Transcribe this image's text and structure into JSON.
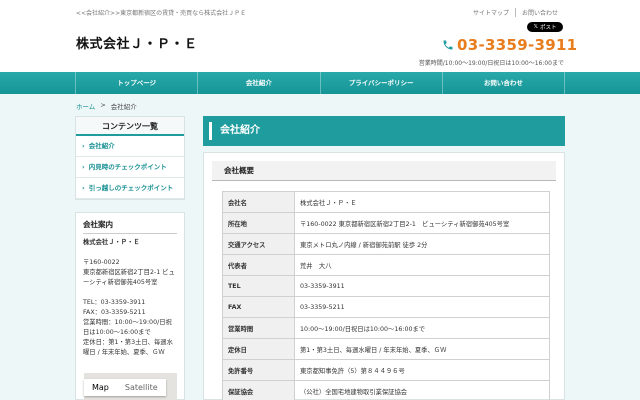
{
  "header": {
    "breadcrumb_text": "<<会社紹介>>東京都新宿区の賃貸・売買なら株式会社ＪＰＥ",
    "top_links": [
      "サイトマップ",
      "お問い合わせ"
    ],
    "post_button": "ポスト",
    "company_name": "株式会社Ｊ・Ｐ・Ｅ",
    "phone": "03-3359-3911",
    "hours": "営業時間/10:00〜19:00/日祝日は10:00〜16:00まで"
  },
  "nav": {
    "items": [
      "トップページ",
      "会社紹介",
      "プライバシーポリシー",
      "お問い合わせ"
    ]
  },
  "crumb": {
    "home": "ホーム",
    "separator": ">",
    "current": "会社紹介"
  },
  "sidebar": {
    "contents_title": "コンテンツ一覧",
    "items": [
      "会社紹介",
      "内見時のチェックポイント",
      "引っ越しのチェックポイント"
    ],
    "info_title": "会社案内",
    "info_company": "株式会社Ｊ・Ｐ・Ｅ",
    "info_postal": "〒160-0022",
    "info_address": "東京都新宿区新宿2丁目2-1 ビューシティ新宿御苑405号室",
    "info_tel": "TEL：03-3359-3911",
    "info_fax": "FAX：03-3359-5211",
    "info_hours": "営業時間：10:00〜19:00/日祝日は10:00〜16:00まで",
    "info_holiday": "定休日：第1・第3土日、毎週水曜日 / 年末年始、夏季、ＧＷ",
    "map_tabs": [
      "Map",
      "Satellite"
    ]
  },
  "main": {
    "title": "会社紹介",
    "subhead": "会社概要",
    "rows": [
      {
        "k": "会社名",
        "v": "株式会社Ｊ・Ｐ・Ｅ"
      },
      {
        "k": "所在地",
        "v": "〒160-0022 東京都新宿区新宿2丁目2-1　ビューシティ新宿御苑405号室"
      },
      {
        "k": "交通アクセス",
        "v": "東京メトロ丸ノ内線 / 新宿御苑前駅 徒歩 2分"
      },
      {
        "k": "代表者",
        "v": "荒井　大八"
      },
      {
        "k": "TEL",
        "v": "03-3359-3911"
      },
      {
        "k": "FAX",
        "v": "03-3359-5211"
      },
      {
        "k": "営業時間",
        "v": "10:00〜19:00/日祝日は10:00〜16:00まで"
      },
      {
        "k": "定休日",
        "v": "第1・第3土日、毎週水曜日 / 年末年始、夏季、ＧＷ"
      },
      {
        "k": "免許番号",
        "v": "東京都知事免許（5）第８４４９６号"
      },
      {
        "k": "保証協会",
        "v": "（公社）全国宅地建物取引業保証協会"
      }
    ]
  },
  "colors": {
    "teal": "#1f9c9e",
    "orange": "#e87d1e"
  }
}
